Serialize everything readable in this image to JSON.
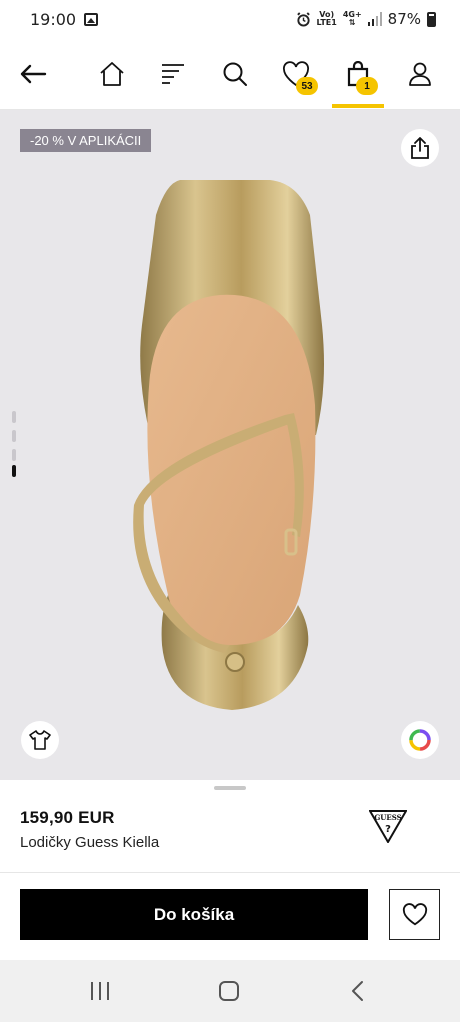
{
  "status_bar": {
    "time": "19:00",
    "network_top": "Vo)",
    "network_bottom": "LTE1",
    "signal_type": "4G+",
    "battery": "87%"
  },
  "nav": {
    "wishlist_count": "53",
    "cart_count": "1",
    "accent_color": "#f5c400"
  },
  "gallery": {
    "promo_label": "-20 % V APLIKÁCII",
    "image_count": 4,
    "active_image": 4
  },
  "product": {
    "price": "159,90 EUR",
    "name": "Lodičky Guess Kiella",
    "brand_logo": "GUESS"
  },
  "actions": {
    "add_to_cart": "Do košíka"
  }
}
